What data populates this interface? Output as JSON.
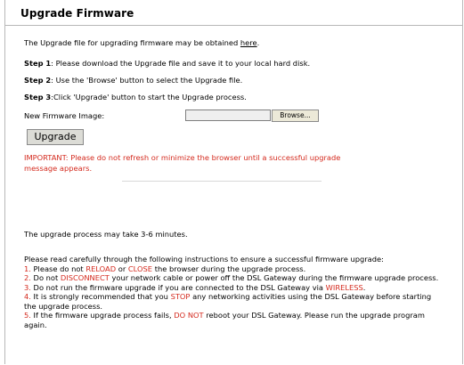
{
  "page": {
    "title": "Upgrade Firmware"
  },
  "intro": {
    "text_before_link": "The Upgrade file for upgrading firmware may be obtained ",
    "link_text": "here",
    "text_after_link": "."
  },
  "steps": [
    {
      "label": "Step 1",
      "text": ": Please download the Upgrade file and save it to your local hard disk."
    },
    {
      "label": "Step 2",
      "text": ": Use the 'Browse' button to select the Upgrade file."
    },
    {
      "label": "Step 3",
      "text": ":Click 'Upgrade' button to start the Upgrade process."
    }
  ],
  "firmware_input": {
    "label": "New Firmware Image:",
    "value": "",
    "browse_label": "Browse..."
  },
  "upgrade_button": {
    "label": "Upgrade"
  },
  "important_notice": "IMPORTANT: Please do not refresh or minimize the browser until a successful upgrade message appears.",
  "duration_note": "The upgrade process may take 3-6 minutes.",
  "instructions": {
    "heading": "Please read carefully through the following instructions to ensure a successful firmware upgrade:",
    "items": [
      {
        "num": "1.",
        "p1": " Please do not ",
        "h1": "RELOAD",
        "p2": " or ",
        "h2": "CLOSE",
        "p3": " the browser during the upgrade process."
      },
      {
        "num": "2.",
        "p1": " Do not ",
        "h1": "DISCONNECT",
        "p2": " your network cable or power off the DSL Gateway during the firmware upgrade process."
      },
      {
        "num": "3.",
        "p1": " Do not run the firmware upgrade if you are connected to the DSL Gateway via ",
        "h1": "WIRELESS",
        "p2": "."
      },
      {
        "num": "4.",
        "p1": " It is strongly recommended that you ",
        "h1": "STOP",
        "p2": " any networking activities using the DSL Gateway before starting the upgrade process."
      },
      {
        "num": "5.",
        "p1": " If the firmware upgrade process fails, ",
        "h1": "DO NOT",
        "p2": " reboot your DSL Gateway. Please run the upgrade program again."
      }
    ]
  },
  "colors": {
    "warning": "#d42a1e",
    "border": "#b8b8b8",
    "button_bg": "#dcdcd6"
  }
}
